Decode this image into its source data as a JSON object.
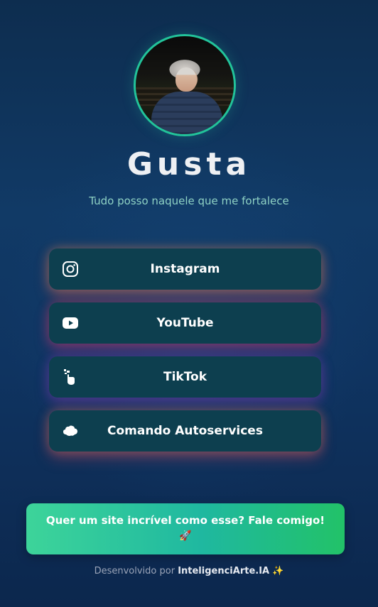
{
  "profile": {
    "name": "Gusta",
    "bio": "Tudo posso naquele que me fortalece"
  },
  "links": [
    {
      "label": "Instagram",
      "icon": "instagram-icon"
    },
    {
      "label": "YouTube",
      "icon": "youtube-icon"
    },
    {
      "label": "TikTok",
      "icon": "tiktok-icon"
    },
    {
      "label": "Comando Autoservices",
      "icon": "cloud-icon"
    }
  ],
  "cta": {
    "text": "Quer um site incrível como esse? Fale comigo!",
    "emoji": "🚀"
  },
  "footer": {
    "prefix": "Desenvolvido por",
    "brand": "InteligenciArte.IA",
    "sparkle": "✨"
  },
  "colors": {
    "accent": "#22c39a",
    "button_bg": "#0d3f4f",
    "bio_text": "#8fd2c4",
    "cta_start": "#3dd49a",
    "cta_end": "#22c268"
  }
}
